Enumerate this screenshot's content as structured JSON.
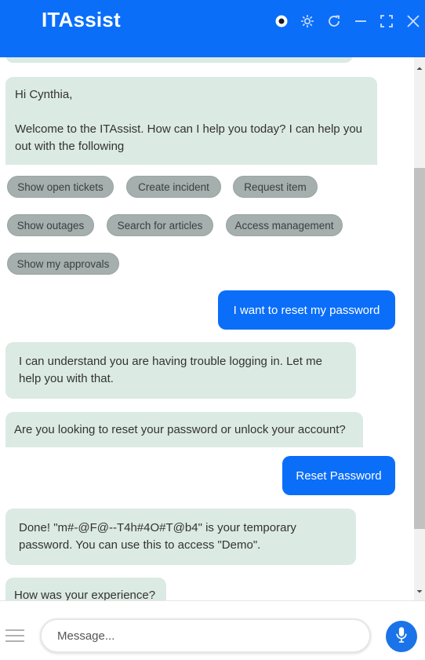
{
  "header": {
    "title": "ITAssist",
    "icons": [
      "record-icon",
      "settings-icon",
      "refresh-icon",
      "minimize-icon",
      "maximize-icon",
      "close-icon"
    ]
  },
  "chat": {
    "welcome": {
      "greeting": "Hi Cynthia,",
      "body": "Welcome to the ITAssist. How can I help you today? I can help you out with the following"
    },
    "quick_replies": [
      "Show open tickets",
      "Create incident",
      "Request item",
      "Show outages",
      "Search for articles",
      "Access management",
      "Show my approvals"
    ],
    "user_message_1": "I want to reset my password",
    "bot_message_1": "I can understand you are having trouble logging in. Let me help you with that.",
    "bot_message_2": "Are you looking to reset your password or unlock your account?",
    "user_message_2": "Reset Password",
    "bot_message_3": "Done! \"m#-@F@--T4h#4O#T@b4\" is your temporary password. You can use this to access \"Demo\".",
    "bot_message_4": "How was your experience?"
  },
  "footer": {
    "placeholder": "Message..."
  },
  "colors": {
    "brand_blue": "#0b6ef9",
    "bot_bubble": "#dbeae3",
    "chip": "#a5afae"
  }
}
